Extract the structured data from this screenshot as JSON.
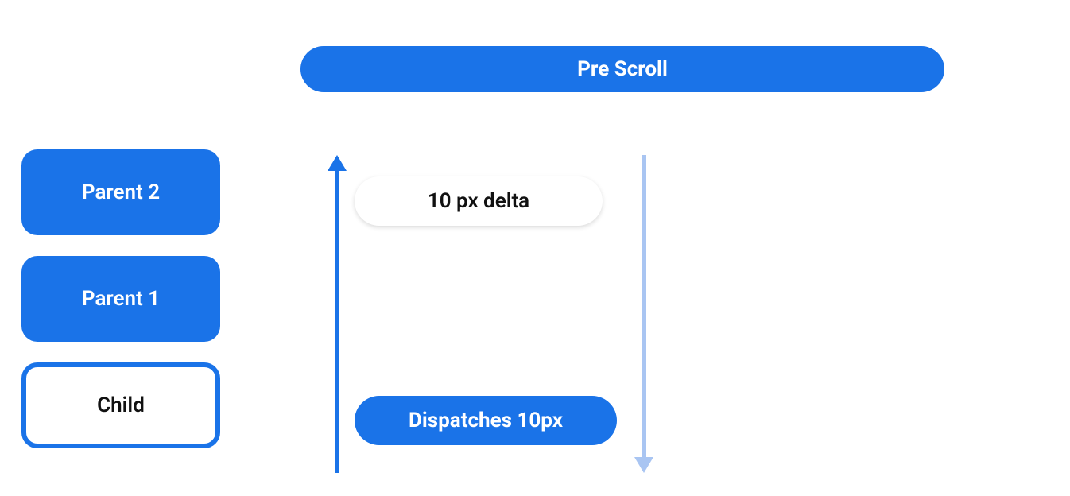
{
  "header": {
    "title": "Pre Scroll"
  },
  "nodes": {
    "parent2": "Parent 2",
    "parent1": "Parent 1",
    "child": "Child"
  },
  "labels": {
    "delta": "10 px delta",
    "dispatch": "Dispatches 10px"
  },
  "colors": {
    "primary": "#1a73e8",
    "primaryLight": "#a9c5f2"
  }
}
